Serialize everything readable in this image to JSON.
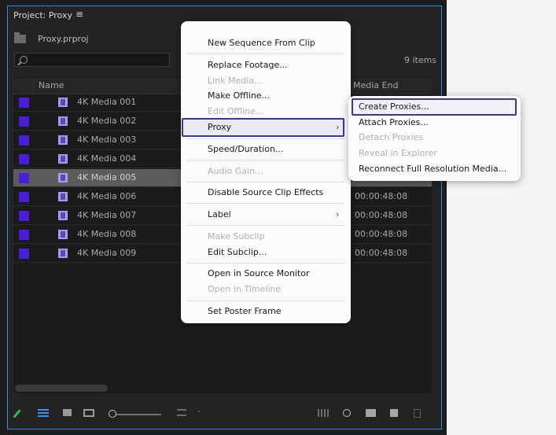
{
  "panel": {
    "title": "Project: Proxy",
    "menu_icon": "hamburger-icon",
    "file_name": "Proxy.prproj",
    "search": {
      "value": "",
      "placeholder": ""
    },
    "items_count": "9 items",
    "columns": {
      "name": "Name",
      "media_end": "Media End"
    }
  },
  "rows": [
    {
      "name": "4K Media 001",
      "media_end": ""
    },
    {
      "name": "4K Media 002",
      "media_end": ""
    },
    {
      "name": "4K Media 003",
      "media_end": ""
    },
    {
      "name": "4K Media 004",
      "media_end": ""
    },
    {
      "name": "4K Media 005",
      "media_end": ""
    },
    {
      "name": "4K Media 006",
      "media_end": "00:00:48:08"
    },
    {
      "name": "4K Media 007",
      "media_end": "00:00:48:08"
    },
    {
      "name": "4K Media 008",
      "media_end": "00:00:48:08"
    },
    {
      "name": "4K Media 009",
      "media_end": "00:00:48:08"
    }
  ],
  "colors": {
    "label": "#4b1fd6",
    "accent": "#2d8ceb",
    "highlight": "#3c3694"
  },
  "context_menu": {
    "new_sequence": "New Sequence From Clip",
    "replace_footage": "Replace Footage...",
    "link_media": "Link Media...",
    "make_offline": "Make Offline...",
    "edit_offline": "Edit Offline...",
    "proxy": "Proxy",
    "speed_duration": "Speed/Duration...",
    "audio_gain": "Audio Gain...",
    "disable_effects": "Disable Source Clip Effects",
    "label": "Label",
    "make_subclip": "Make Subclip",
    "edit_subclip": "Edit Subclip...",
    "open_source_monitor": "Open in Source Monitor",
    "open_timeline": "Open in Timeline",
    "set_poster_frame": "Set Poster Frame"
  },
  "proxy_submenu": {
    "create": "Create Proxies...",
    "attach": "Attach Proxies...",
    "detach": "Detach Proxies",
    "reveal": "Reveal in Explorer",
    "reconnect": "Reconnect Full Resolution Media..."
  }
}
